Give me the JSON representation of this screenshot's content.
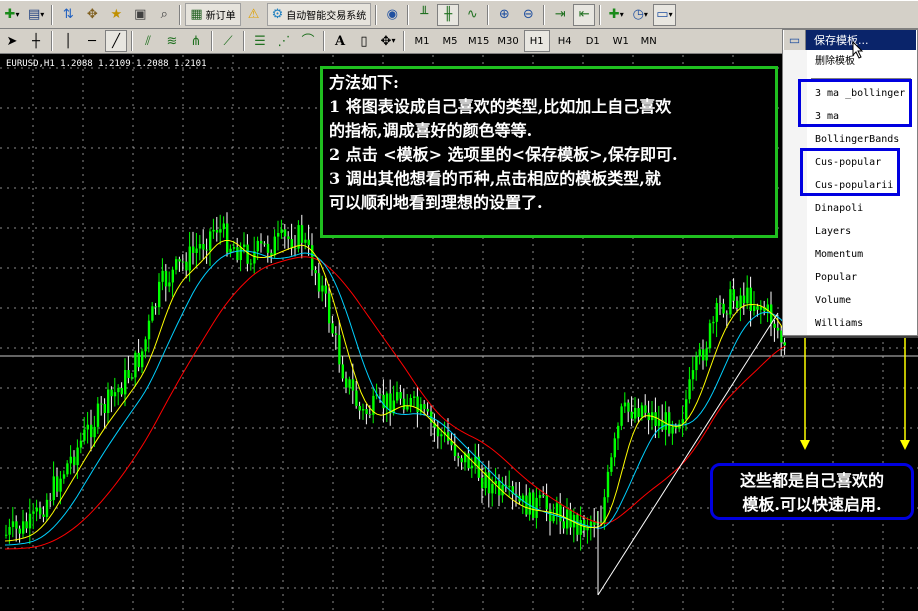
{
  "toolbar1": {
    "new_order_label": "新订单",
    "expert_advisors_label": "自动智能交易系统"
  },
  "toolbar2": {
    "timeframes": [
      "M1",
      "M5",
      "M15",
      "M30",
      "H1",
      "H4",
      "D1",
      "W1",
      "MN"
    ],
    "active_timeframe": "H1",
    "text_tool_label": "A"
  },
  "chart": {
    "caption": "EURUSD,H1  1.2088 1.2109 1.2088 1.2101",
    "colors": {
      "background": "#000000",
      "bull_candle": "#00ff00",
      "bear_candle": "#ffffff",
      "ma_fast": "#ffff00",
      "ma_mid": "#00d0ff",
      "ma_slow": "#ff0000",
      "grid": "#ffffff"
    }
  },
  "note": {
    "lines": [
      "方法如下:",
      "1 将图表设成自己喜欢的类型,比如加上自己喜欢",
      "的指标,调成喜好的颜色等等.",
      "2 点击 <模板> 选项里的<保存模板>,保存即可.",
      "3 调出其他想看的币种,点击相应的模板类型,就",
      "可以顺利地看到理想的设置了."
    ]
  },
  "template_menu": {
    "save_label": "保存模板...",
    "delete_label": "删除模板",
    "templates": [
      "3 ma _bollinger",
      "3 ma",
      "BollingerBands",
      "Cus-popular",
      "Cus-popularii",
      "Dinapoli",
      "Layers",
      "Momentum",
      "Popular",
      "Volume",
      "Williams"
    ]
  },
  "callout": {
    "lines": [
      "这些都是自己喜欢的",
      "模板.可以快速启用."
    ]
  }
}
